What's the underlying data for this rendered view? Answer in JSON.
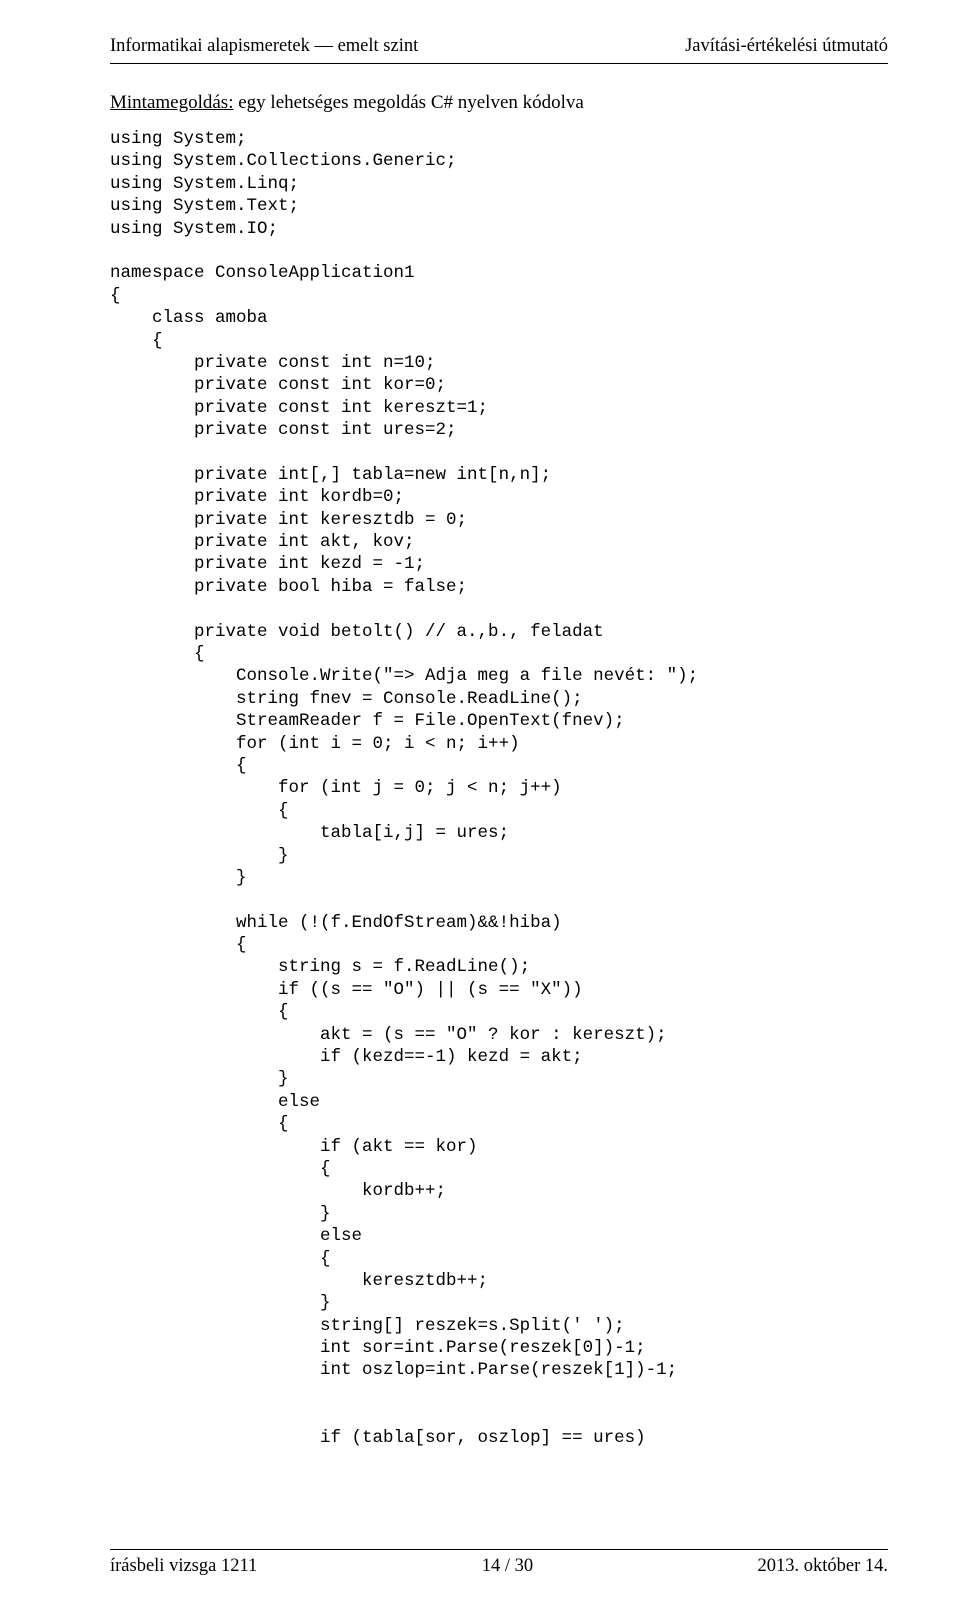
{
  "header": {
    "left": "Informatikai alapismeretek — emelt szint",
    "right": "Javítási-értékelési útmutató"
  },
  "title": {
    "underlined": "Mintamegoldás:",
    "rest": " egy lehetséges megoldás C# nyelven kódolva"
  },
  "code": "using System;\nusing System.Collections.Generic;\nusing System.Linq;\nusing System.Text;\nusing System.IO;\n\nnamespace ConsoleApplication1\n{\n    class amoba\n    {\n        private const int n=10;\n        private const int kor=0;\n        private const int kereszt=1;\n        private const int ures=2;\n\n        private int[,] tabla=new int[n,n];\n        private int kordb=0;\n        private int keresztdb = 0;\n        private int akt, kov;\n        private int kezd = -1;\n        private bool hiba = false;\n\n        private void betolt() // a.,b., feladat\n        {\n            Console.Write(\"=> Adja meg a file nevét: \");\n            string fnev = Console.ReadLine();\n            StreamReader f = File.OpenText(fnev);\n            for (int i = 0; i < n; i++)\n            {\n                for (int j = 0; j < n; j++)\n                {\n                    tabla[i,j] = ures;\n                }\n            }\n\n            while (!(f.EndOfStream)&&!hiba)\n            {\n                string s = f.ReadLine();\n                if ((s == \"O\") || (s == \"X\"))\n                {\n                    akt = (s == \"O\" ? kor : kereszt);\n                    if (kezd==-1) kezd = akt;\n                }\n                else\n                {\n                    if (akt == kor)\n                    {\n                        kordb++;\n                    }\n                    else\n                    {\n                        keresztdb++;\n                    }\n                    string[] reszek=s.Split(' ');\n                    int sor=int.Parse(reszek[0])-1;\n                    int oszlop=int.Parse(reszek[1])-1;\n\n\n                    if (tabla[sor, oszlop] == ures)",
  "footer": {
    "left": "írásbeli vizsga 1211",
    "center": "14 / 30",
    "right": "2013. október 14."
  }
}
